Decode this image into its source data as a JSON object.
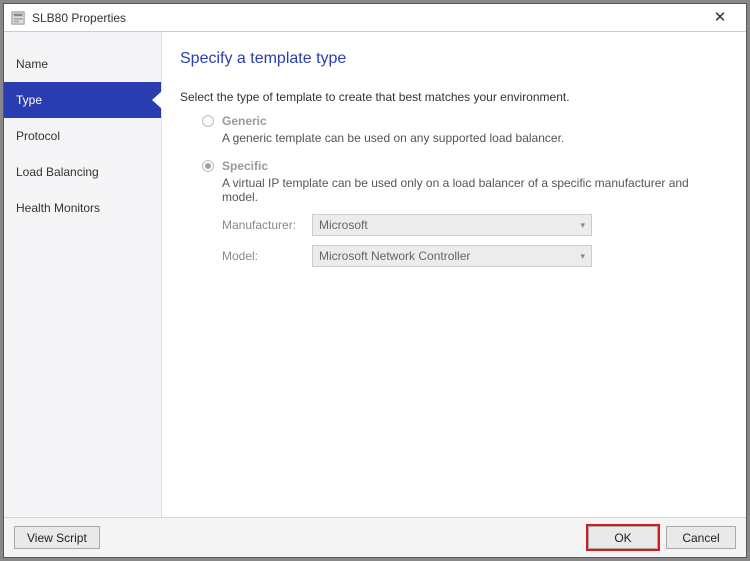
{
  "window": {
    "title": "SLB80 Properties"
  },
  "sidebar": {
    "items": [
      {
        "label": "Name"
      },
      {
        "label": "Type"
      },
      {
        "label": "Protocol"
      },
      {
        "label": "Load Balancing"
      },
      {
        "label": "Health Monitors"
      }
    ],
    "selected_index": 1
  },
  "content": {
    "heading": "Specify a template type",
    "lead": "Select the type of template to create that best matches your environment.",
    "options": {
      "generic": {
        "label": "Generic",
        "desc": "A generic template can be used on any supported load balancer."
      },
      "specific": {
        "label": "Specific",
        "desc": "A virtual IP template can be used only on a load balancer of a specific manufacturer and model."
      }
    },
    "fields": {
      "manufacturer": {
        "label": "Manufacturer:",
        "value": "Microsoft"
      },
      "model": {
        "label": "Model:",
        "value": "Microsoft Network Controller"
      }
    }
  },
  "footer": {
    "view_script": "View Script",
    "ok": "OK",
    "cancel": "Cancel"
  }
}
